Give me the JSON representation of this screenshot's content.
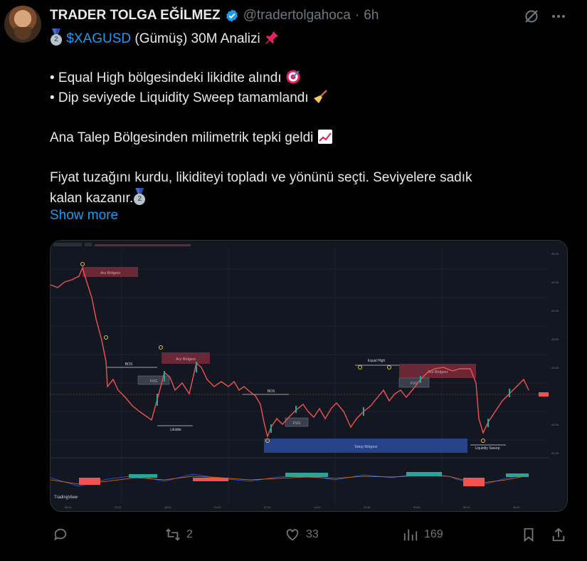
{
  "author": {
    "name": "TRADER TOLGA EĞİLMEZ",
    "handle": "@tradertolgahoca",
    "separator": "·",
    "time": "6h"
  },
  "tweet": {
    "cashtag": "$XAGUSD",
    "title_rest": " (Gümüş) 30M Analizi",
    "bullet1": "• Equal High bölgesindeki likidite alındı",
    "bullet2": "• Dip seviyede Liquidity Sweep tamamlandı",
    "line3": "Ana Talep Bölgesinden milimetrik tepki geldi",
    "line4": "Fiyat tuzağını kurdu, likiditeyi topladı ve yönünü seçti. Seviyelere sadık",
    "line5": "kalan kazanır.",
    "show_more": "Show more"
  },
  "chart_labels": {
    "sell_zone_1": "Arz Bölgesi",
    "sell_zone_2": "Arz Bölgesi",
    "sell_zone_3": "Arz Bölgesi",
    "bos_1": "BOS",
    "bos_2": "BOS",
    "fvg_1": "FVG",
    "fvg_2": "FVG",
    "fvg_3": "FVG",
    "liquidity": "Likidite",
    "equal_high": "Equal High",
    "demand_zone": "Talep Bölgesi",
    "liquidity_sweep": "Liquidity Sweep",
    "brand": "TradingView"
  },
  "actions": {
    "replies": "",
    "reposts": "2",
    "likes": "33",
    "views": "169"
  },
  "colors": {
    "accent": "#1d9bf0",
    "muted": "#71767b",
    "bull": "#26a69a",
    "bear": "#ef5350",
    "chart_bg": "#131722"
  },
  "icons": [
    "verified-badge-icon",
    "grok-icon",
    "more-icon",
    "reply-icon",
    "repost-icon",
    "like-icon",
    "views-icon",
    "bookmark-icon",
    "share-icon",
    "medal-icon",
    "pushpin-icon",
    "target-icon",
    "broom-icon",
    "chart-up-icon"
  ]
}
